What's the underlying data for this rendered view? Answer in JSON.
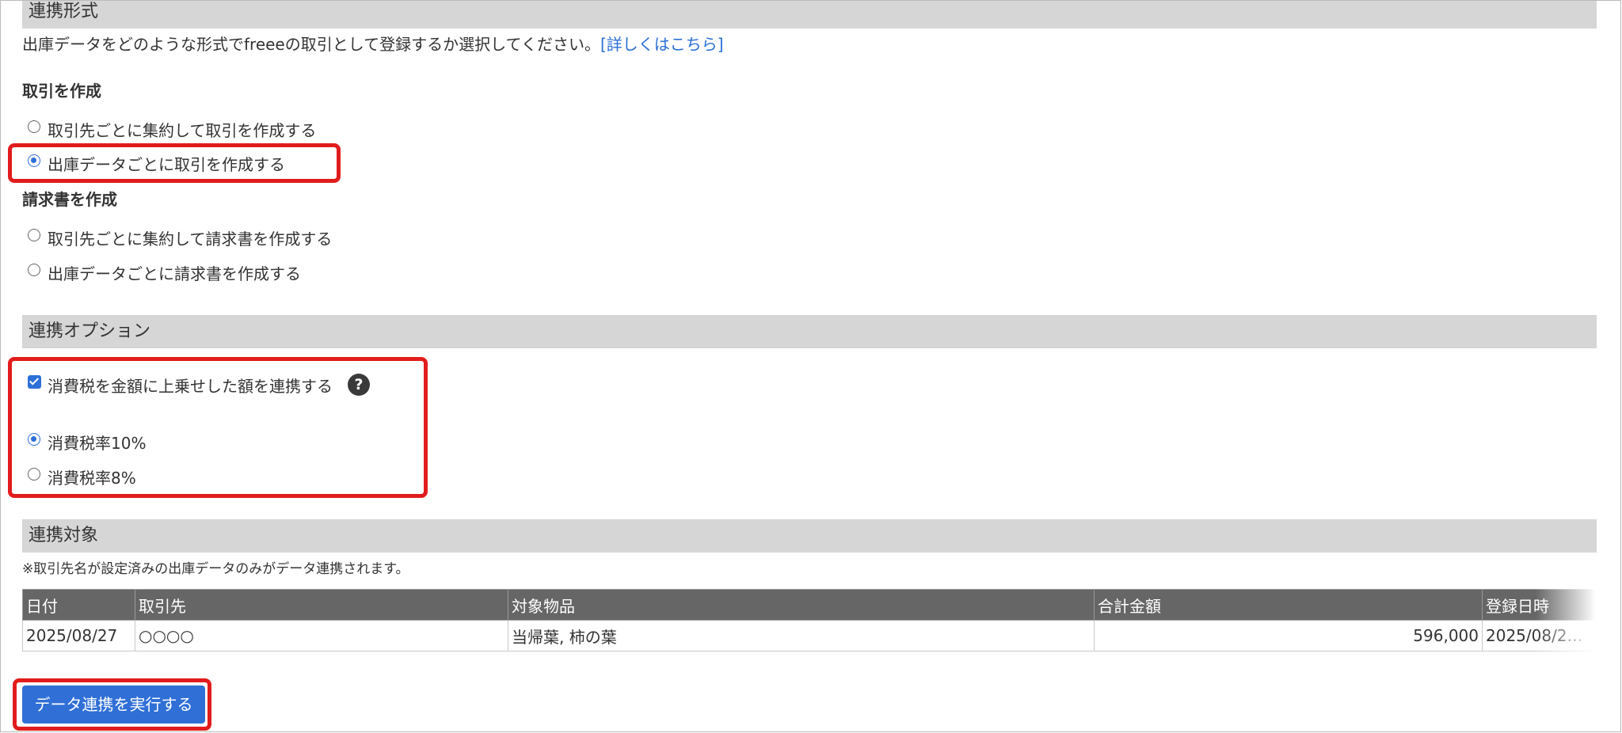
{
  "format_section": {
    "title": "連携形式",
    "description": "出庫データをどのような形式でfreeeの取引として登録するか選択してください。",
    "details_link": "[詳しくはこちら]",
    "transaction_group": {
      "heading": "取引を作成",
      "options": [
        {
          "label": "取引先ごとに集約して取引を作成する",
          "selected": false
        },
        {
          "label": "出庫データごとに取引を作成する",
          "selected": true
        }
      ]
    },
    "invoice_group": {
      "heading": "請求書を作成",
      "options": [
        {
          "label": "取引先ごとに集約して請求書を作成する",
          "selected": false
        },
        {
          "label": "出庫データごとに請求書を作成する",
          "selected": false
        }
      ]
    }
  },
  "options_section": {
    "title": "連携オプション",
    "tax_checkbox": {
      "label": "消費税を金額に上乗せした額を連携する",
      "checked": true
    },
    "help_icon": "?",
    "tax_rates": [
      {
        "label": "消費税率10%",
        "selected": true
      },
      {
        "label": "消費税率8%",
        "selected": false
      }
    ]
  },
  "target_section": {
    "title": "連携対象",
    "note": "※取引先名が設定済みの出庫データのみがデータ連携されます。",
    "table": {
      "headers": [
        "日付",
        "取引先",
        "対象物品",
        "合計金額",
        "登録日時"
      ],
      "rows": [
        [
          "2025/08/27",
          "○○○○",
          "当帰葉, 柿の葉",
          "596,000",
          "2025/08/2…"
        ]
      ]
    }
  },
  "execute_button": "データ連携を実行する",
  "colors": {
    "accent": "#2f6fd6",
    "highlight": "#e21c1c",
    "section_bar": "#d6d6d6",
    "table_header": "#666666"
  }
}
